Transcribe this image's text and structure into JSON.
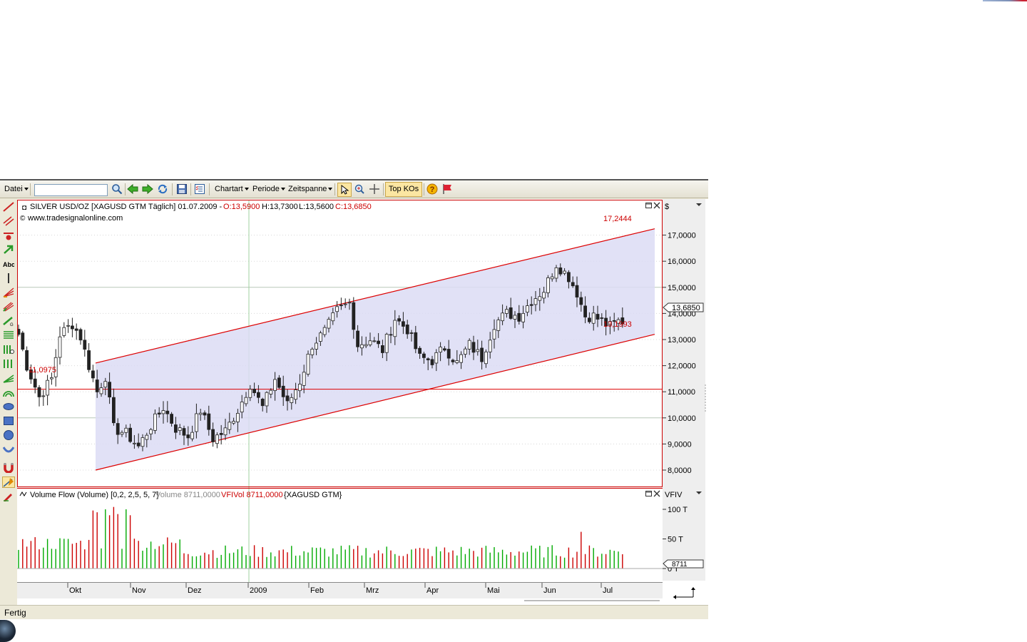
{
  "toolbar": {
    "file_menu": "Datei",
    "search_value": "",
    "chart_type_menu": "Chartart",
    "period_menu": "Periode",
    "timespan_menu": "Zeitspanne",
    "top_kos_button": "Top KOs"
  },
  "price_panel": {
    "title": "SILVER USD/OZ [XAGUSD GTM  Täglich] 01.07.2009 - ",
    "ohlc_open": "O:13,5900",
    "ohlc_high": "H:13,7300",
    "ohlc_low": "L:13,5600",
    "ohlc_close": "C:13,6850",
    "website": "www.tradesignalonline.com",
    "currency": "$",
    "last_price": "13,6850",
    "upper_channel_label": "17,2444",
    "lower_channel_label": "13,1993",
    "horizontal_line_label": "11,0975",
    "colors": {
      "up": "#00aa00",
      "down": "#cc0000",
      "channel": "#dd0000",
      "channel_fill": "#dcdcf4"
    }
  },
  "volume_panel": {
    "title_name": "Volume Flow (Volume) [0,2, 2,5, 5, 7]",
    "title_volume": "Volume 8711,0000",
    "title_vfivol": "VFIVol 8711,0000",
    "title_symbol": "{XAGUSD GTM}",
    "axis_name": "VFIV",
    "last_value": "8711"
  },
  "x_axis_labels": [
    "Okt",
    "Nov",
    "Dez",
    "2009",
    "Feb",
    "Mrz",
    "Apr",
    "Mai",
    "Jun",
    "Jul"
  ],
  "status_text": "Fertig",
  "chart_data": {
    "type": "candlestick",
    "x_range": [
      "Sep 2008",
      "Jul 2009"
    ],
    "y_ticks": [
      "8,0000",
      "9,0000",
      "10,0000",
      "11,0000",
      "12,0000",
      "13,0000",
      "14,0000",
      "15,0000",
      "16,0000",
      "17,0000"
    ],
    "ylim": [
      7,
      18
    ],
    "volume_ticks": [
      "100 T",
      "50 T",
      "0 T"
    ],
    "volume_ylim": [
      0,
      110
    ],
    "path_closes": [
      [
        0,
        13.2
      ],
      [
        2,
        12.0
      ],
      [
        5,
        10.8
      ],
      [
        8,
        11.5
      ],
      [
        10,
        13.2
      ],
      [
        13,
        13.6
      ],
      [
        15,
        13.1
      ],
      [
        17,
        12.0
      ],
      [
        19,
        11.0
      ],
      [
        21,
        11.6
      ],
      [
        23,
        9.6
      ],
      [
        26,
        9.4
      ],
      [
        29,
        8.9
      ],
      [
        32,
        9.7
      ],
      [
        35,
        10.4
      ],
      [
        38,
        9.6
      ],
      [
        41,
        9.3
      ],
      [
        44,
        10.3
      ],
      [
        47,
        9.2
      ],
      [
        50,
        9.5
      ],
      [
        53,
        10.3
      ],
      [
        56,
        11.3
      ],
      [
        59,
        10.4
      ],
      [
        62,
        11.5
      ],
      [
        65,
        10.5
      ],
      [
        68,
        11.4
      ],
      [
        71,
        12.8
      ],
      [
        74,
        13.3
      ],
      [
        77,
        14.1
      ],
      [
        80,
        14.4
      ],
      [
        82,
        12.8
      ],
      [
        85,
        13.0
      ],
      [
        88,
        12.6
      ],
      [
        91,
        13.8
      ],
      [
        94,
        13.4
      ],
      [
        97,
        12.3
      ],
      [
        100,
        12.2
      ],
      [
        103,
        12.7
      ],
      [
        106,
        12.1
      ],
      [
        109,
        12.8
      ],
      [
        112,
        12.3
      ],
      [
        115,
        13.6
      ],
      [
        118,
        14.0
      ],
      [
        121,
        13.9
      ],
      [
        124,
        14.5
      ],
      [
        127,
        14.9
      ],
      [
        130,
        15.9
      ],
      [
        133,
        15.4
      ],
      [
        135,
        14.8
      ],
      [
        137,
        13.9
      ],
      [
        139,
        13.9
      ],
      [
        141,
        13.7
      ],
      [
        143,
        13.5
      ],
      [
        145,
        13.7
      ]
    ],
    "volume_spikes": [
      {
        "bar": 18,
        "value": 98
      },
      {
        "bar": 19,
        "value": 95
      },
      {
        "bar": 21,
        "value": 100
      },
      {
        "bar": 22,
        "value": 90
      },
      {
        "bar": 23,
        "value": 104
      },
      {
        "bar": 24,
        "value": 92
      },
      {
        "bar": 26,
        "value": 100
      },
      {
        "bar": 27,
        "value": 90
      },
      {
        "bar": 136,
        "value": 62
      }
    ],
    "channel": {
      "upper_start": 12.1,
      "upper_end": 17.2444,
      "lower_start": 8.0,
      "lower_end": 13.1993
    },
    "horizontal_line": 11.0975
  }
}
